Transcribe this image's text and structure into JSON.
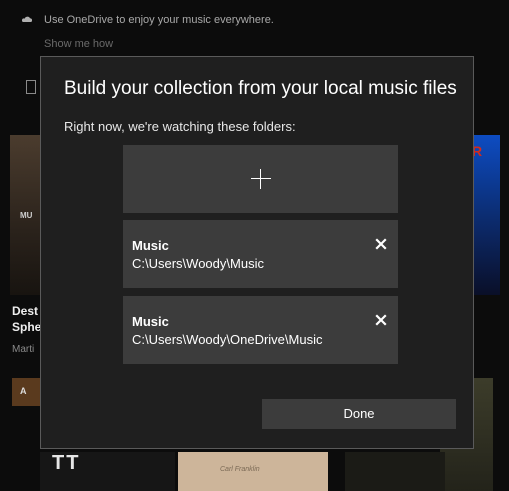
{
  "background": {
    "banner": {
      "icon": "cloud-icon",
      "message": "Use OneDrive to enjoy your music everywhere.",
      "link": "Show me how"
    },
    "album_tiles": [
      {
        "text": "MU"
      },
      {
        "text": "R"
      },
      {
        "text": "A"
      },
      {
        "text": "TT"
      },
      {
        "text": "Carl Franklin"
      }
    ],
    "album_title": "Dest Sphe",
    "album_artist": "Marti"
  },
  "dialog": {
    "title": "Build your collection from your local music files",
    "subtitle": "Right now, we're watching these folders:",
    "add_icon": "plus-icon",
    "folders": [
      {
        "name": "Music",
        "path": "C:\\Users\\Woody\\Music",
        "remove_icon": "close-icon"
      },
      {
        "name": "Music",
        "path": "C:\\Users\\Woody\\OneDrive\\Music",
        "remove_icon": "close-icon"
      }
    ],
    "done_label": "Done"
  }
}
